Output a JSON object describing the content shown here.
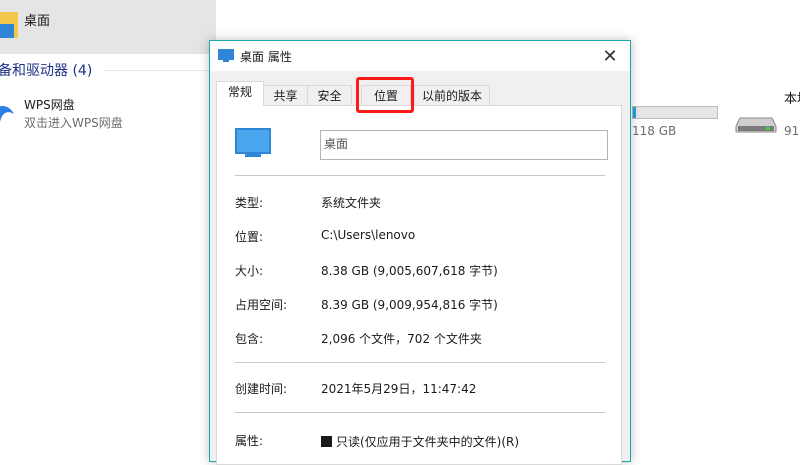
{
  "explorer": {
    "desktop_item": "桌面",
    "group_header": "备和驱动器 (4)",
    "wps": {
      "name": "WPS网盘",
      "subtitle": "双击进入WPS网盘"
    },
    "drive1": {
      "free_text": "118 GB",
      "fill_fraction": 0.03
    },
    "drive2": {
      "label": "本地",
      "sub": "91"
    }
  },
  "dialog": {
    "title": "桌面 属性",
    "close_glyph": "✕",
    "tabs": [
      {
        "label": "常规",
        "active": true
      },
      {
        "label": "共享",
        "active": false
      },
      {
        "label": "安全",
        "active": false
      },
      {
        "label": "位置",
        "active": false
      },
      {
        "label": "以前的版本",
        "active": false
      }
    ],
    "highlighted_tab": "位置",
    "name_field": "桌面",
    "properties": {
      "type": {
        "label": "类型:",
        "value": "系统文件夹"
      },
      "location": {
        "label": "位置:",
        "value": "C:\\Users\\lenovo"
      },
      "size": {
        "label": "大小:",
        "value": "8.38 GB (9,005,607,618 字节)"
      },
      "size_on_disk": {
        "label": "占用空间:",
        "value": "8.39 GB (9,009,954,816 字节)"
      },
      "contains": {
        "label": "包含:",
        "value": "2,096 个文件，702 个文件夹"
      },
      "created": {
        "label": "创建时间:",
        "value": "2021年5月29日，11:47:42"
      },
      "attributes": {
        "label": "属性:",
        "readonly_label": "只读(仅应用于文件夹中的文件)(R)"
      }
    }
  },
  "colors": {
    "accent": "#26a0da",
    "dialog_border": "#1aa7a8",
    "highlight": "#ff1a1a"
  }
}
